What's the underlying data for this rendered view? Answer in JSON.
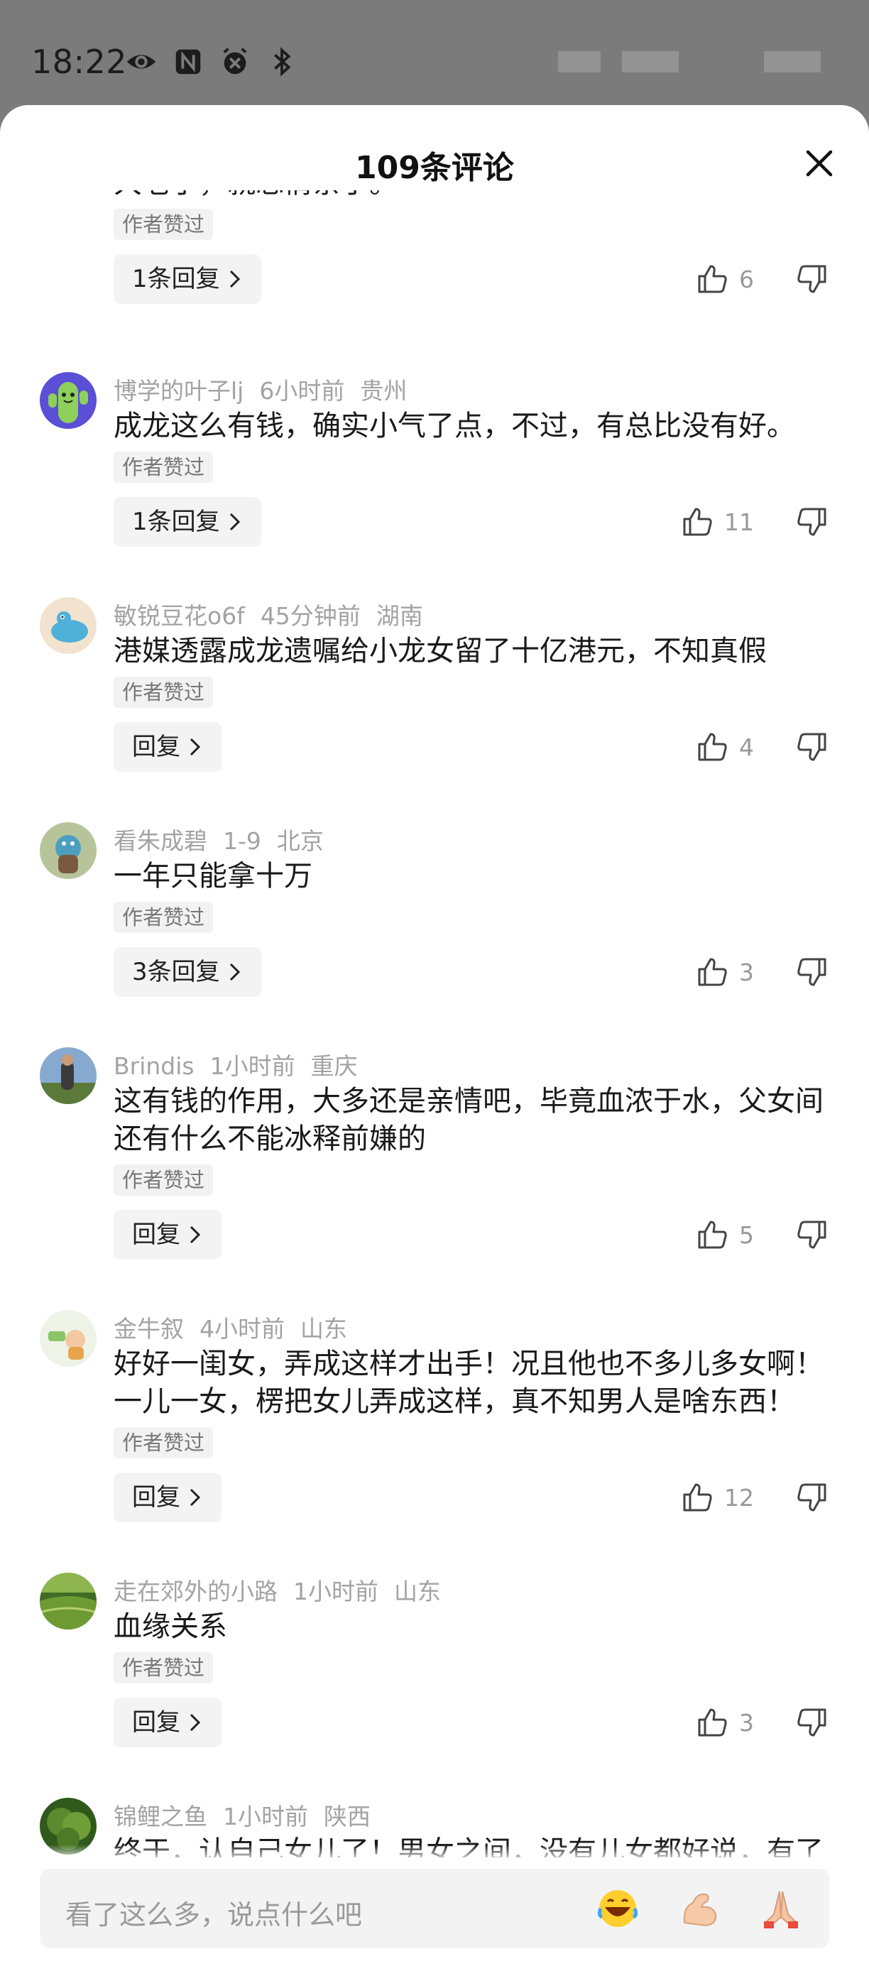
{
  "status_bar": {
    "time": "18:22"
  },
  "sheet": {
    "title": "109条评论",
    "input_placeholder": "看了这么多，说点什么吧"
  },
  "comments": [
    {
      "partial_text": "大老了，就忘情亲了。",
      "tag": "作者赞过",
      "reply_label": "1条回复",
      "likes": "6"
    },
    {
      "username": "博学的叶子lj",
      "time": "6小时前",
      "location": "贵州",
      "text": "成龙这么有钱，确实小气了点，不过，有总比没有好。",
      "tag": "作者赞过",
      "reply_label": "1条回复",
      "likes": "11"
    },
    {
      "username": "敏锐豆花o6f",
      "time": "45分钟前",
      "location": "湖南",
      "text": "港媒透露成龙遗嘱给小龙女留了十亿港元，不知真假",
      "tag": "作者赞过",
      "reply_label": "回复",
      "likes": "4"
    },
    {
      "username": "看朱成碧",
      "time": "1-9",
      "location": "北京",
      "text": "一年只能拿十万",
      "tag": "作者赞过",
      "reply_label": "3条回复",
      "likes": "3"
    },
    {
      "username": "Brindis",
      "time": "1小时前",
      "location": "重庆",
      "text_line1": "这有钱的作用，大多还是亲情吧，毕竟血浓于水，父女间",
      "text_line2": "还有什么不能冰释前嫌的",
      "tag": "作者赞过",
      "reply_label": "回复",
      "likes": "5"
    },
    {
      "username": "金牛叙",
      "time": "4小时前",
      "location": "山东",
      "text_line1": "好好一闺女，弄成这样才出手！况且他也不多儿多女啊！",
      "text_line2": "一儿一女，楞把女儿弄成这样，真不知男人是啥东西！",
      "tag": "作者赞过",
      "reply_label": "回复",
      "likes": "12"
    },
    {
      "username": "走在郊外的小路",
      "time": "1小时前",
      "location": "山东",
      "text": "血缘关系",
      "tag": "作者赞过",
      "reply_label": "回复",
      "likes": "3"
    },
    {
      "username": "锦鲤之鱼",
      "time": "1小时前",
      "location": "陕西",
      "partial_text": "终于，认自己女儿了！男女之间，没有儿女都好说，有了"
    }
  ]
}
